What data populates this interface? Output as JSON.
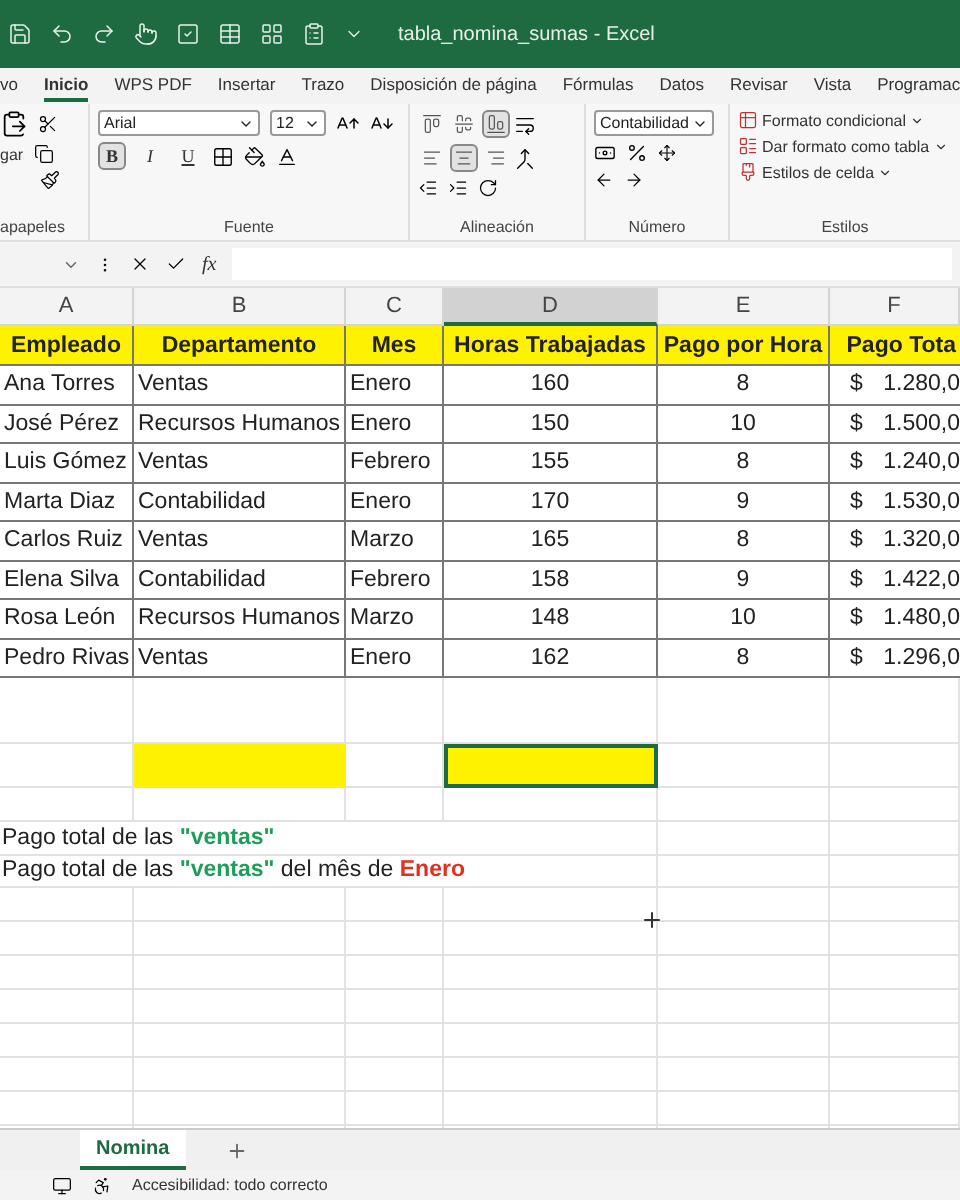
{
  "title_bar": {
    "title": "tabla_nomina_sumas - Excel"
  },
  "ribbon_tabs": [
    {
      "label": "vo",
      "selected": false
    },
    {
      "label": "Inicio",
      "selected": true
    },
    {
      "label": "WPS PDF",
      "selected": false
    },
    {
      "label": "Insertar",
      "selected": false
    },
    {
      "label": "Trazo",
      "selected": false
    },
    {
      "label": "Disposición de página",
      "selected": false
    },
    {
      "label": "Fórmulas",
      "selected": false
    },
    {
      "label": "Datos",
      "selected": false
    },
    {
      "label": "Revisar",
      "selected": false
    },
    {
      "label": "Vista",
      "selected": false
    },
    {
      "label": "Programac",
      "selected": false
    }
  ],
  "ribbon": {
    "clipboard": {
      "paste_label": "gar",
      "group_label": "apapeles"
    },
    "font": {
      "font_name": "Arial",
      "font_size": "12",
      "style_buttons": [
        {
          "label": "B",
          "selected": true
        },
        {
          "label": "I",
          "selected": false
        },
        {
          "label": "U",
          "selected": false
        }
      ],
      "group_label": "Fuente"
    },
    "alignment": {
      "vertical": [
        {
          "selected": false
        },
        {
          "selected": false
        },
        {
          "selected": true
        }
      ],
      "horizontal": [
        {
          "selected": false
        },
        {
          "selected": true
        },
        {
          "selected": false
        }
      ],
      "group_label": "Alineación"
    },
    "number": {
      "format": "Contabilidad",
      "group_label": "Número"
    },
    "styles": {
      "buttons": [
        "Formato condicional",
        "Dar formato como tabla",
        "Estilos de celda"
      ],
      "group_label": "Estilos"
    }
  },
  "formula_bar": {
    "function_label": "fx"
  },
  "sheet": {
    "columns": [
      {
        "label": "A",
        "selected": false
      },
      {
        "label": "B",
        "selected": false
      },
      {
        "label": "C",
        "selected": false
      },
      {
        "label": "D",
        "selected": true
      },
      {
        "label": "E",
        "selected": false
      },
      {
        "label": "F",
        "selected": false
      }
    ],
    "header": [
      "Empleado",
      "Departamento",
      "Mes",
      "Horas Trabajadas",
      "Pago por Hora",
      "Pago Tota"
    ],
    "rows": [
      {
        "employee": "Ana Torres",
        "department": "Ventas",
        "month": "Enero",
        "hours": "160",
        "rate": "8",
        "currency": "$",
        "total": "1.280,0"
      },
      {
        "employee": "José Pérez",
        "department": "Recursos Humanos",
        "month": "Enero",
        "hours": "150",
        "rate": "10",
        "currency": "$",
        "total": "1.500,0"
      },
      {
        "employee": "Luis Gómez",
        "department": "Ventas",
        "month": "Febrero",
        "hours": "155",
        "rate": "8",
        "currency": "$",
        "total": "1.240,0"
      },
      {
        "employee": "Marta Diaz",
        "department": "Contabilidad",
        "month": "Enero",
        "hours": "170",
        "rate": "9",
        "currency": "$",
        "total": "1.530,0"
      },
      {
        "employee": "Carlos Ruiz",
        "department": "Ventas",
        "month": "Marzo",
        "hours": "165",
        "rate": "8",
        "currency": "$",
        "total": "1.320,0"
      },
      {
        "employee": "Elena Silva",
        "department": "Contabilidad",
        "month": "Febrero",
        "hours": "158",
        "rate": "9",
        "currency": "$",
        "total": "1.422,0"
      },
      {
        "employee": "Rosa León",
        "department": "Recursos Humanos",
        "month": "Marzo",
        "hours": "148",
        "rate": "10",
        "currency": "$",
        "total": "1.480,0"
      },
      {
        "employee": "Pedro Rivas",
        "department": "Ventas",
        "month": "Enero",
        "hours": "162",
        "rate": "8",
        "currency": "$",
        "total": "1.296,0"
      }
    ],
    "highlight_cells": [
      {
        "selected": false
      },
      {
        "selected": true
      }
    ],
    "notes": [
      {
        "parts": [
          {
            "text": "Pago total de las ",
            "kind": "plain"
          },
          {
            "text": "\"ventas\"",
            "kind": "green"
          }
        ]
      },
      {
        "parts": [
          {
            "text": "Pago total de las ",
            "kind": "plain"
          },
          {
            "text": "\"ventas\"",
            "kind": "green"
          },
          {
            "text": " del mês de ",
            "kind": "plain"
          },
          {
            "text": "Enero",
            "kind": "red"
          }
        ]
      }
    ]
  },
  "sheet_tabs": [
    {
      "label": "Nomina",
      "selected": true
    }
  ],
  "status_bar": {
    "accessibility": "Accesibilidad: todo correcto"
  }
}
